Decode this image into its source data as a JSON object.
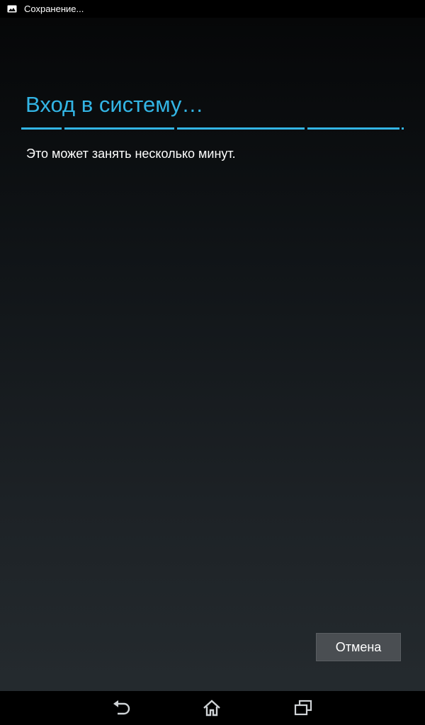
{
  "status_bar": {
    "notification_icon": "image-icon",
    "text": "Сохранение..."
  },
  "dialog": {
    "title": "Вход в систему…",
    "message": "Это может занять несколько минут.",
    "cancel_label": "Отмена"
  },
  "nav_bar": {
    "back_icon": "back-icon",
    "home_icon": "home-icon",
    "recents_icon": "recent-apps-icon"
  },
  "colors": {
    "accent": "#33b5e5",
    "button_bg": "#4a4e52",
    "background_top": "#050607",
    "background_bottom": "#262c30"
  }
}
